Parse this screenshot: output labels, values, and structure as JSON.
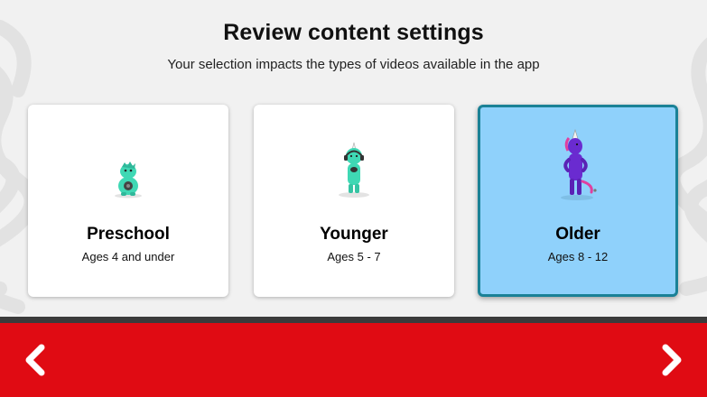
{
  "header": {
    "title": "Review content settings",
    "subtitle": "Your selection impacts the types of videos available in the app"
  },
  "cards": [
    {
      "name": "Preschool",
      "ages": "Ages 4 and under",
      "icon": "small-teal-monster-icon",
      "selected": false
    },
    {
      "name": "Younger",
      "ages": "Ages 5 - 7",
      "icon": "teal-unicorn-with-headphones-icon",
      "selected": false
    },
    {
      "name": "Older",
      "ages": "Ages 8 - 12",
      "icon": "purple-unicorn-icon",
      "selected": true
    }
  ],
  "footer": {
    "back_icon": "chevron-left-icon",
    "next_icon": "chevron-right-icon"
  },
  "colors": {
    "background": "#f1f1f1",
    "footer_red": "#e00b13",
    "divider": "#3b3b3b",
    "selected_card": "#8fd1fb",
    "selected_border": "#1a8196",
    "monster_teal": "#3fd8b4",
    "unicorn_purple": "#6a2bd0"
  }
}
